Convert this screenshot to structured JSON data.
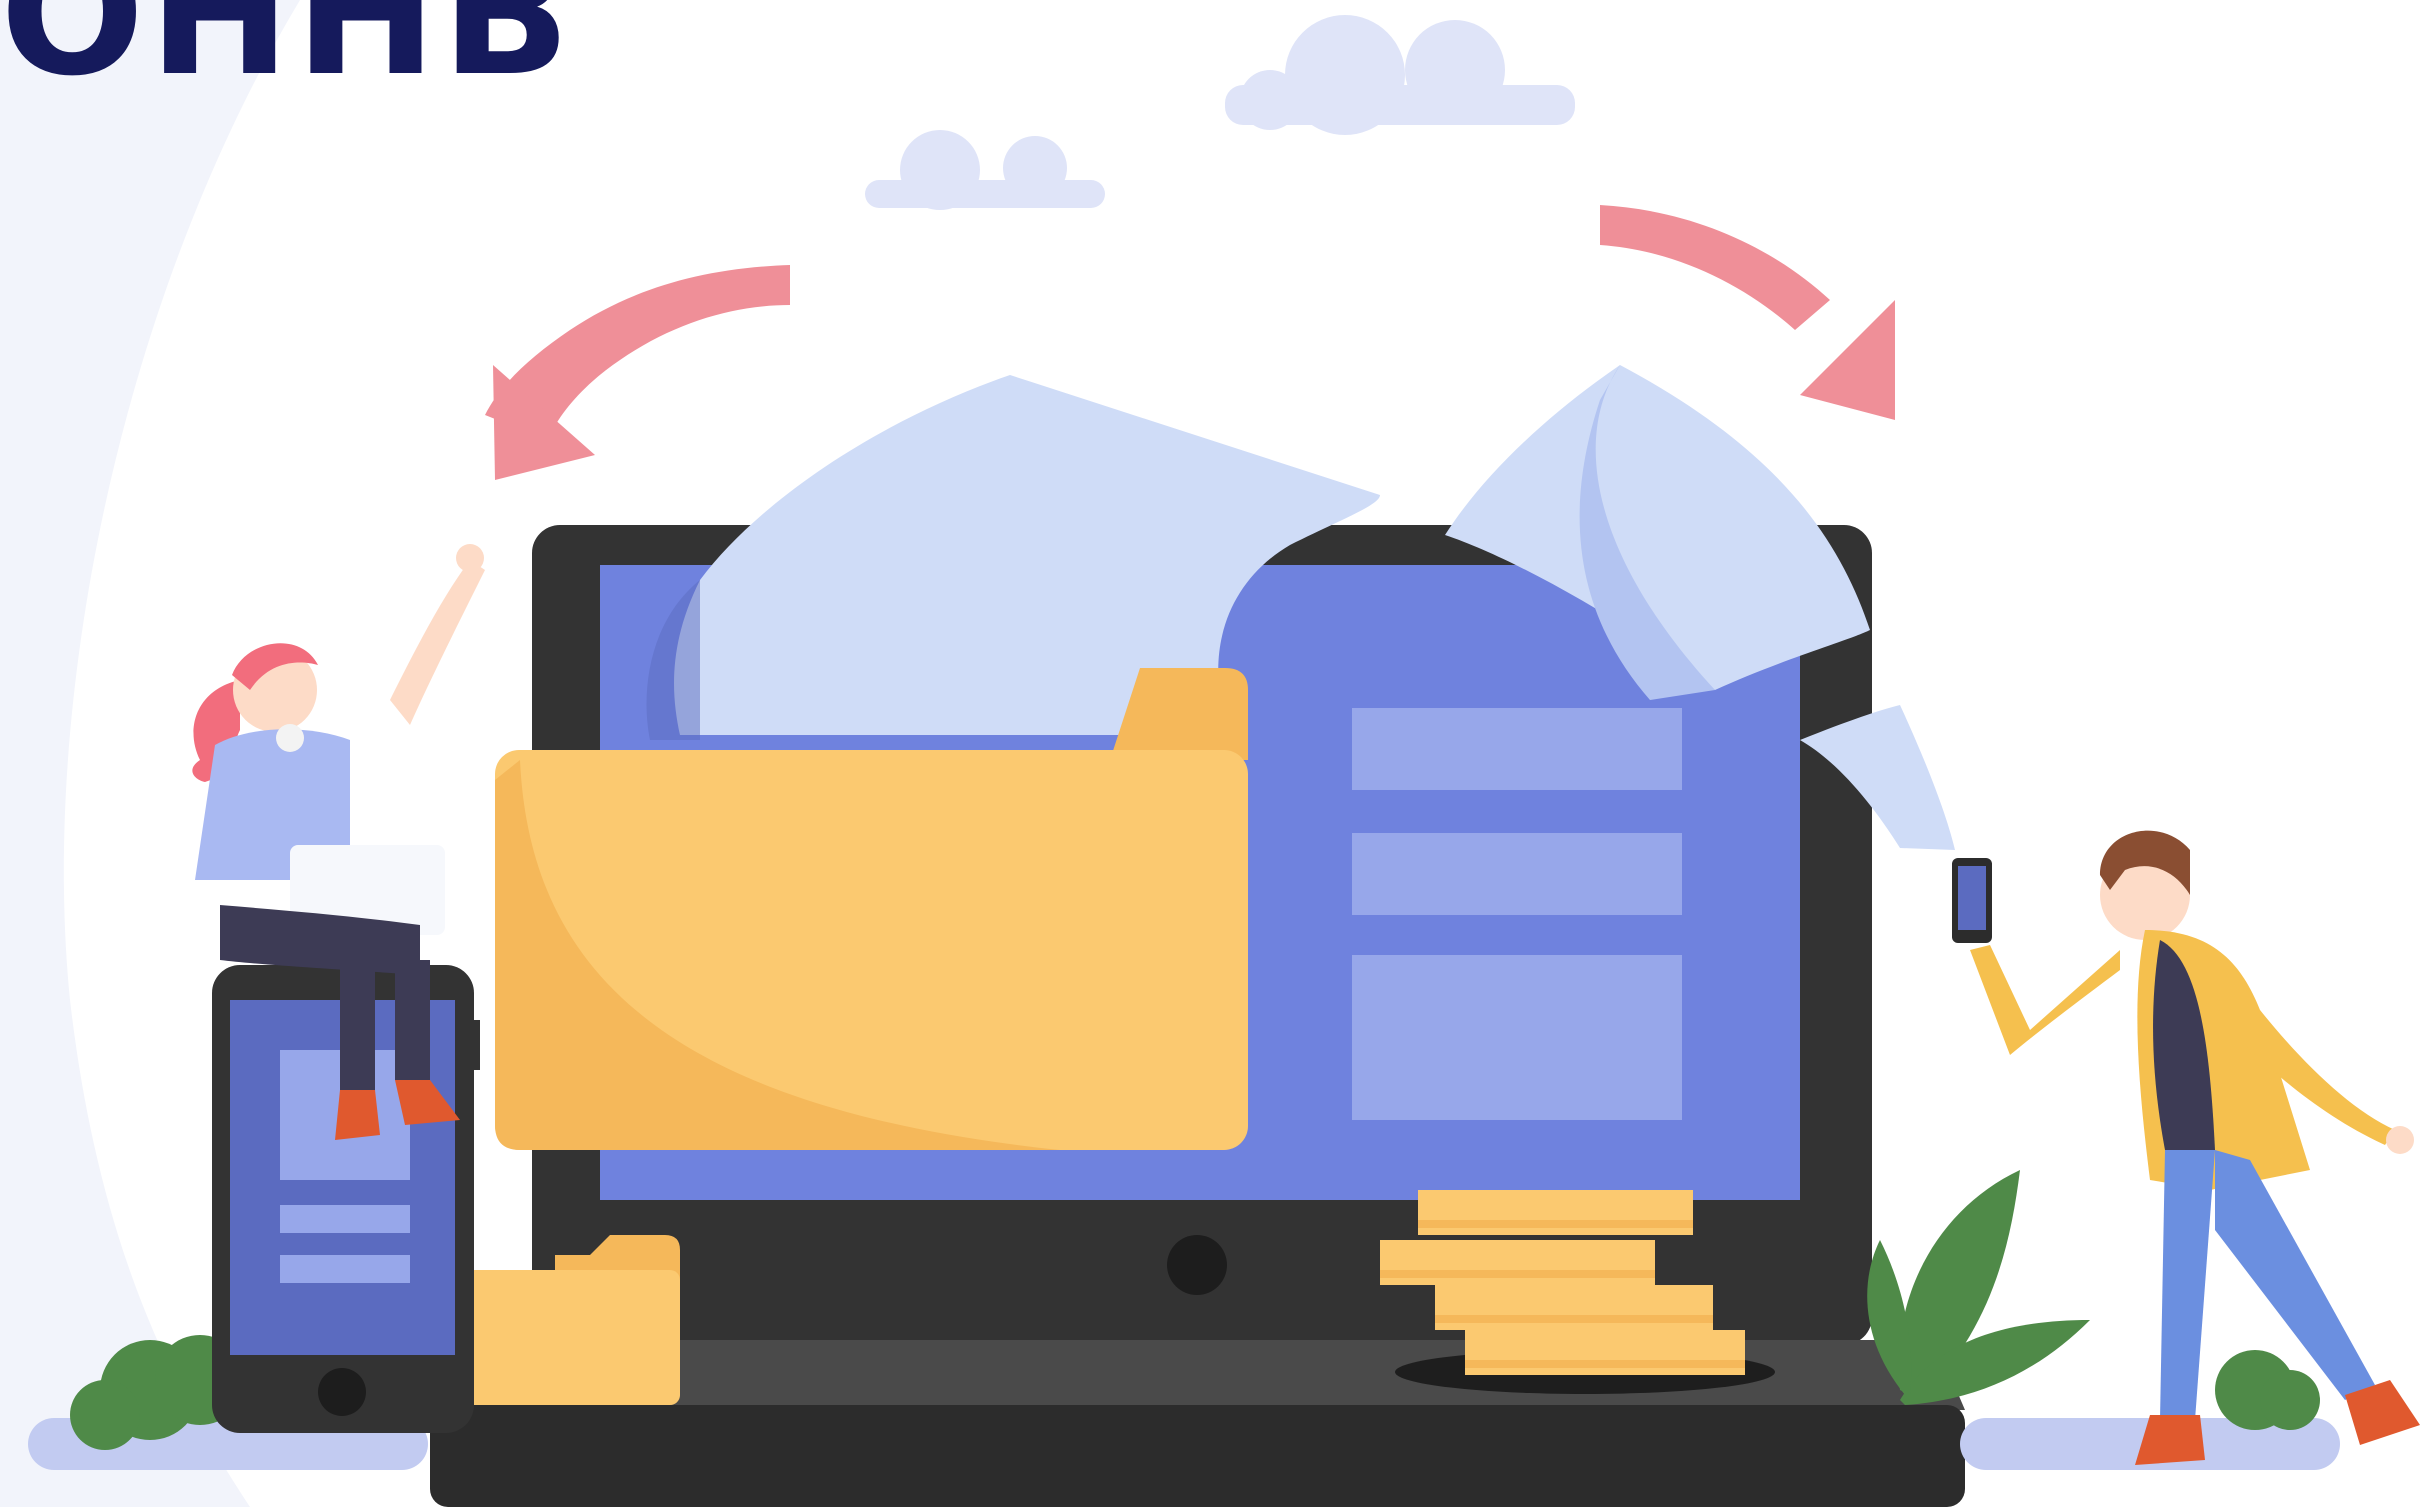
{
  "heading": {
    "text": "OHHB"
  },
  "colors": {
    "background": "#ffffff",
    "arc": "#f2f4fb",
    "cloud": "#dfe4f8",
    "arrow": "#ef8f98",
    "laptop_body": "#333333",
    "laptop_base": "#2c2c2c",
    "screen": "#6f82de",
    "screen_panel": "#97a7ea",
    "folder": "#fbc970",
    "folder_shadow": "#f5b85a",
    "document": "#cfdcf7",
    "coin": "#fbc970",
    "plant": "#4f8a48",
    "heading": "#151a5c"
  },
  "illustration": {
    "objects": [
      "laptop",
      "folder",
      "documents",
      "coin-stack",
      "smartphone",
      "person-sitting-with-laptop",
      "person-holding-phone",
      "arrows",
      "clouds",
      "plants"
    ]
  }
}
